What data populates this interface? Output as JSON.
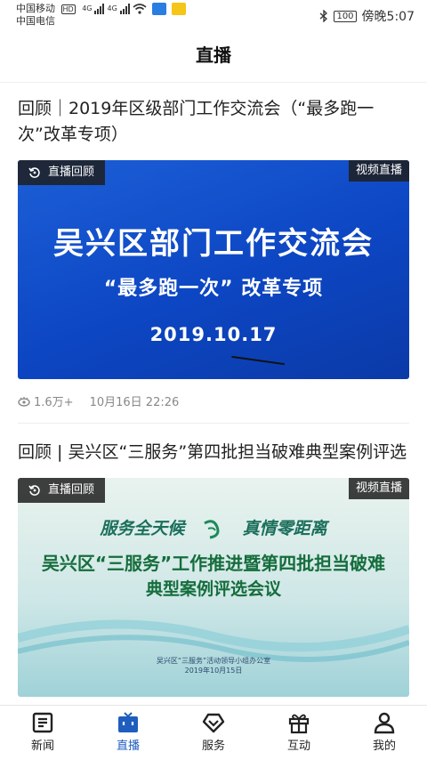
{
  "status": {
    "carrier1": "中国移动",
    "hd": "HD",
    "net1": "4G",
    "net2": "4G",
    "carrier2": "中国电信",
    "battery": "100",
    "time": "傍晚5:07"
  },
  "header": {
    "title": "直播"
  },
  "articles": [
    {
      "title": "回顾｜2019年区级部门工作交流会（“最多跑一次”改革专项）",
      "live_tag": "直播回顾",
      "video_tag": "视频直播",
      "banner": {
        "line1": "吴兴区部门工作交流会",
        "line2": "“最多跑一次”  改革专项",
        "date": "2019.10.17"
      },
      "views": "1.6万+",
      "time": "10月16日 22:26"
    },
    {
      "title": "回顾 | 吴兴区“三服务”第四批担当破难典型案例评选",
      "live_tag": "直播回顾",
      "video_tag": "视频直播",
      "banner": {
        "slogan_left": "服务全天候",
        "slogan_right": "真情零距离",
        "title": "吴兴区“三服务”工作推进暨第四批担当破难",
        "subtitle": "典型案例评选会议",
        "footer1": "吴兴区“三服务”活动领导小组办公室",
        "footer2": "2019年10月15日"
      }
    }
  ],
  "tabbar": [
    {
      "label": "新闻",
      "icon": "news-icon"
    },
    {
      "label": "直播",
      "icon": "tv-icon"
    },
    {
      "label": "服务",
      "icon": "heart-diamond-icon"
    },
    {
      "label": "互动",
      "icon": "gift-icon"
    },
    {
      "label": "我的",
      "icon": "user-icon"
    }
  ],
  "colors": {
    "accent": "#1f5dbf",
    "banner_blue": "#0d46c3",
    "banner_green": "#156d3c"
  }
}
